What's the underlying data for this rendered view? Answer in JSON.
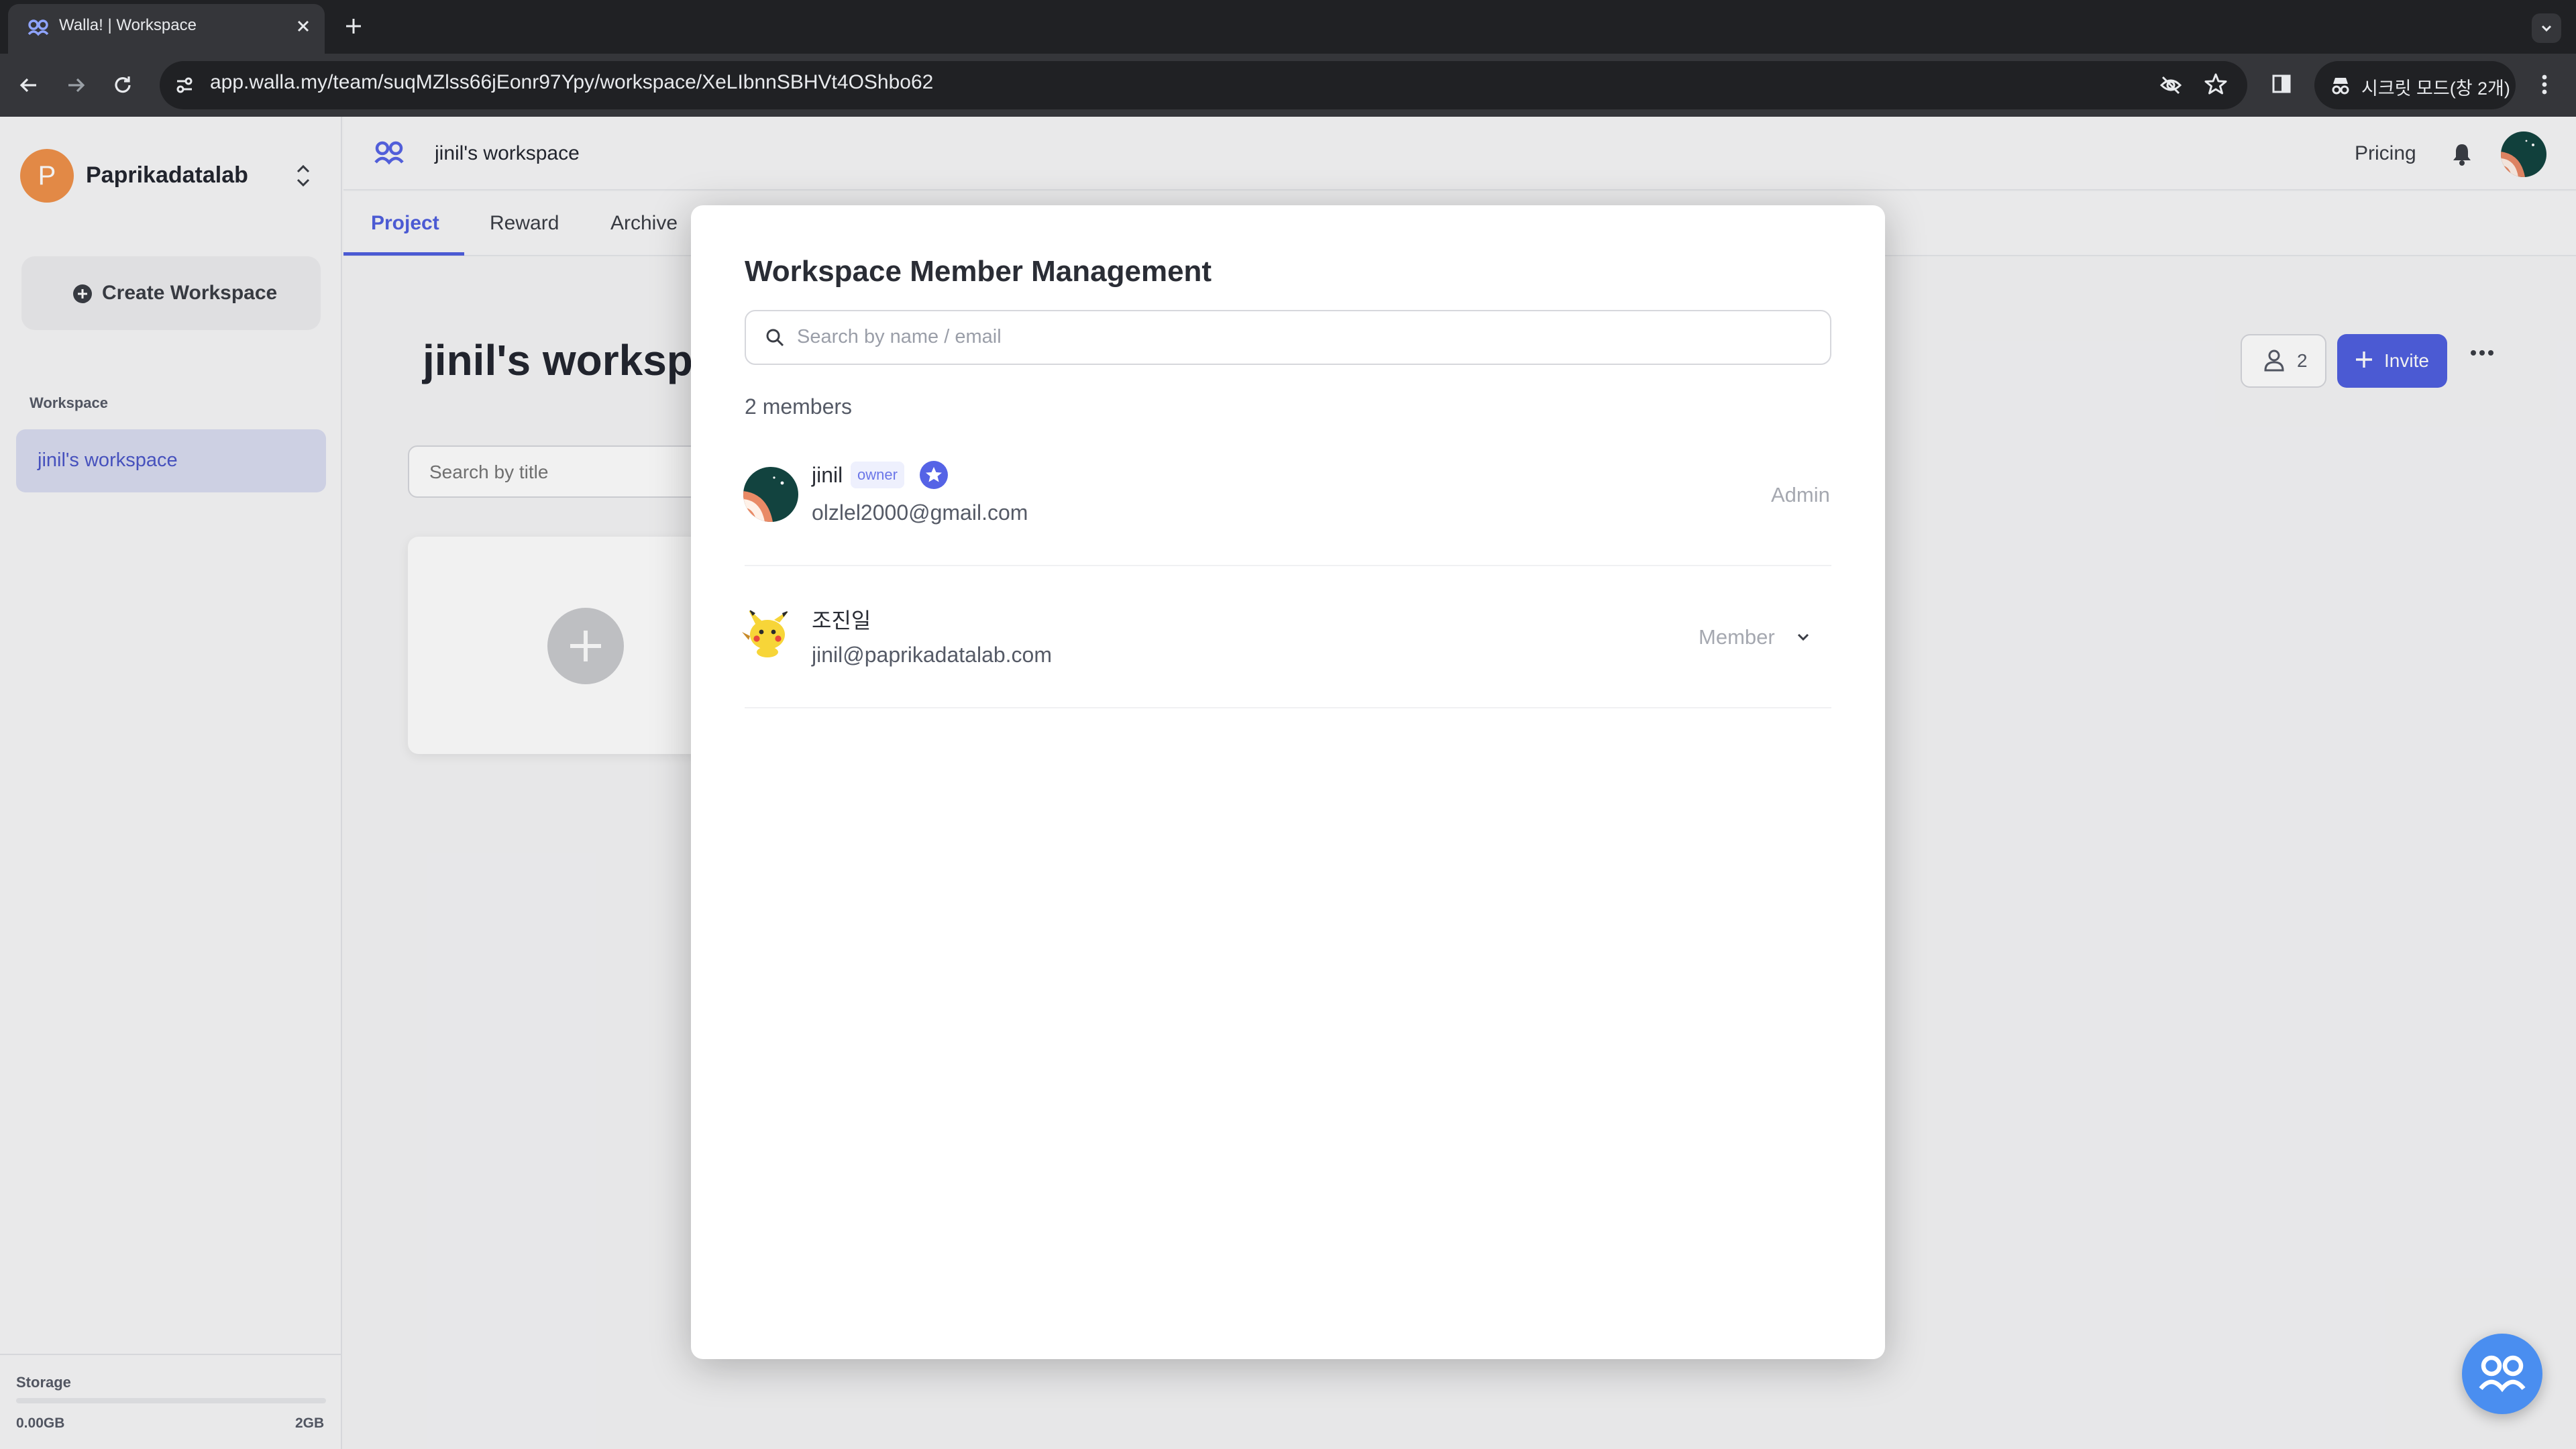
{
  "browser": {
    "tab_title": "Walla! | Workspace",
    "url": "app.walla.my/team/suqMZlss66jEonr97Ypy/workspace/XeLIbnnSBHVt4OShbo62",
    "incognito_label": "시크릿 모드(창 2개)"
  },
  "sidebar": {
    "team_initial": "P",
    "team_name": "Paprikadatalab",
    "create_workspace": "Create Workspace",
    "section_label": "Workspace",
    "workspaces": [
      {
        "label": "jinil's workspace"
      }
    ],
    "storage": {
      "label": "Storage",
      "used": "0.00GB",
      "total": "2GB",
      "fraction": 0.0
    }
  },
  "header": {
    "workspace_title": "jinil's workspace",
    "pricing": "Pricing"
  },
  "tabs": [
    {
      "label": "Project",
      "active": true
    },
    {
      "label": "Reward",
      "active": false
    },
    {
      "label": "Archive",
      "active": false
    }
  ],
  "main": {
    "heading": "jinil's workspace",
    "search_placeholder": "Search by title",
    "member_count": "2",
    "invite_label": "Invite"
  },
  "modal": {
    "title": "Workspace Member Management",
    "search_placeholder": "Search by name / email",
    "member_count_label": "2 members",
    "members": [
      {
        "name": "jinil",
        "badge": "owner",
        "email": "olzlel2000@gmail.com",
        "role": "Admin"
      },
      {
        "name": "조진일",
        "email": "jinil@paprikadatalab.com",
        "role": "Member"
      }
    ]
  },
  "colors": {
    "accent": "#4f5fe0",
    "team_avatar": "#f0914a",
    "active_sidebar_item": "#d9dcf1",
    "chat_fab": "#4a8ef0"
  },
  "icons": [
    "walla-logo-icon",
    "close-icon",
    "plus-icon",
    "chevron-down-icon",
    "back-arrow-icon",
    "forward-arrow-icon",
    "reload-icon",
    "site-info-icon",
    "eye-off-icon",
    "star-icon",
    "side-panel-icon",
    "incognito-icon",
    "more-vert-icon",
    "chevron-updown-icon",
    "bell-icon",
    "user-icon",
    "more-horiz-icon",
    "search-icon",
    "owner-star-icon"
  ]
}
